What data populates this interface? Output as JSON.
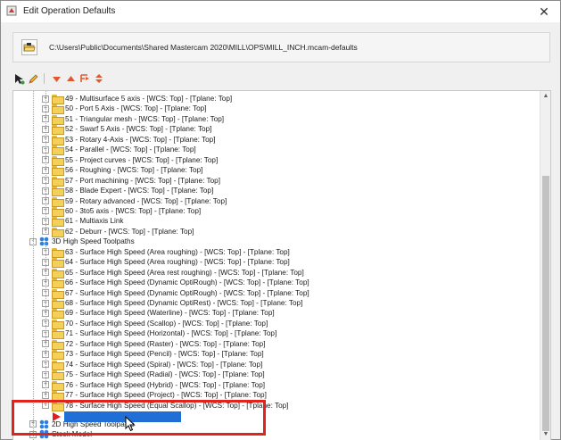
{
  "window": {
    "title": "Edit Operation Defaults",
    "close_glyph": "✕"
  },
  "pathbar": {
    "path": "C:\\Users\\Public\\Documents\\Shared Mastercam 2020\\MILL\\OPS\\MILL_INCH.mcam-defaults"
  },
  "toolbar": {
    "icons": [
      "select-arrow-icon",
      "edit-pencil-icon",
      "move-down-icon",
      "move-up-icon",
      "insert-point-icon",
      "expand-collapse-icon"
    ]
  },
  "tree": {
    "multiaxis_items": [
      "49 - Multisurface 5 axis - [WCS: Top] - [Tplane: Top]",
      "50 - Port 5 Axis - [WCS: Top] - [Tplane: Top]",
      "51 - Triangular mesh - [WCS: Top] - [Tplane: Top]",
      "52 - Swarf 5 Axis - [WCS: Top] - [Tplane: Top]",
      "53 - Rotary 4-Axis - [WCS: Top] - [Tplane: Top]",
      "54 - Parallel - [WCS: Top] - [Tplane: Top]",
      "55 - Project curves - [WCS: Top] - [Tplane: Top]",
      "56 - Roughing - [WCS: Top] - [Tplane: Top]",
      "57 - Port machining - [WCS: Top] - [Tplane: Top]",
      "58 - Blade Expert - [WCS: Top] - [Tplane: Top]",
      "59 - Rotary advanced - [WCS: Top] - [Tplane: Top]",
      "60 - 3to5 axis - [WCS: Top] - [Tplane: Top]",
      "61 - Multiaxis Link",
      "62 - Deburr - [WCS: Top] - [Tplane: Top]"
    ],
    "group_3d_hs": "3D High Speed Toolpaths",
    "hs_items": [
      "63 - Surface High Speed (Area roughing) - [WCS: Top] - [Tplane: Top]",
      "64 - Surface High Speed (Area roughing) - [WCS: Top] - [Tplane: Top]",
      "65 - Surface High Speed (Area rest roughing) - [WCS: Top] - [Tplane: Top]",
      "66 - Surface High Speed (Dynamic OptiRough) - [WCS: Top] - [Tplane: Top]",
      "67 - Surface High Speed (Dynamic OptiRough) - [WCS: Top] - [Tplane: Top]",
      "68 - Surface High Speed (Dynamic OptiRest) - [WCS: Top] - [Tplane: Top]",
      "69 - Surface High Speed (Waterline) - [WCS: Top] - [Tplane: Top]",
      "70 - Surface High Speed (Scallop) - [WCS: Top] - [Tplane: Top]",
      "71 - Surface High Speed (Horizontal) - [WCS: Top] - [Tplane: Top]",
      "72 - Surface High Speed (Raster) - [WCS: Top] - [Tplane: Top]",
      "73 - Surface High Speed (Pencil) - [WCS: Top] - [Tplane: Top]",
      "74 - Surface High Speed (Spiral) - [WCS: Top] - [Tplane: Top]",
      "75 - Surface High Speed (Radial) - [WCS: Top] - [Tplane: Top]",
      "76 - Surface High Speed (Hybrid) - [WCS: Top] - [Tplane: Top]",
      "77 - Surface High Speed (Project) - [WCS: Top] - [Tplane: Top]",
      "78 - Surface High Speed (Equal Scallop) - [WCS: Top] - [Tplane: Top]"
    ],
    "group_2d_hs": "2D High Speed Toolpaths",
    "group_stock": "Stock Model",
    "new_item_edit_value": ""
  },
  "colors": {
    "folder_yellow": "#f4cf59",
    "group_blue": "#2f7fe0",
    "edit_highlight": "#1f6fd6",
    "annotation_red": "#e0241b"
  }
}
